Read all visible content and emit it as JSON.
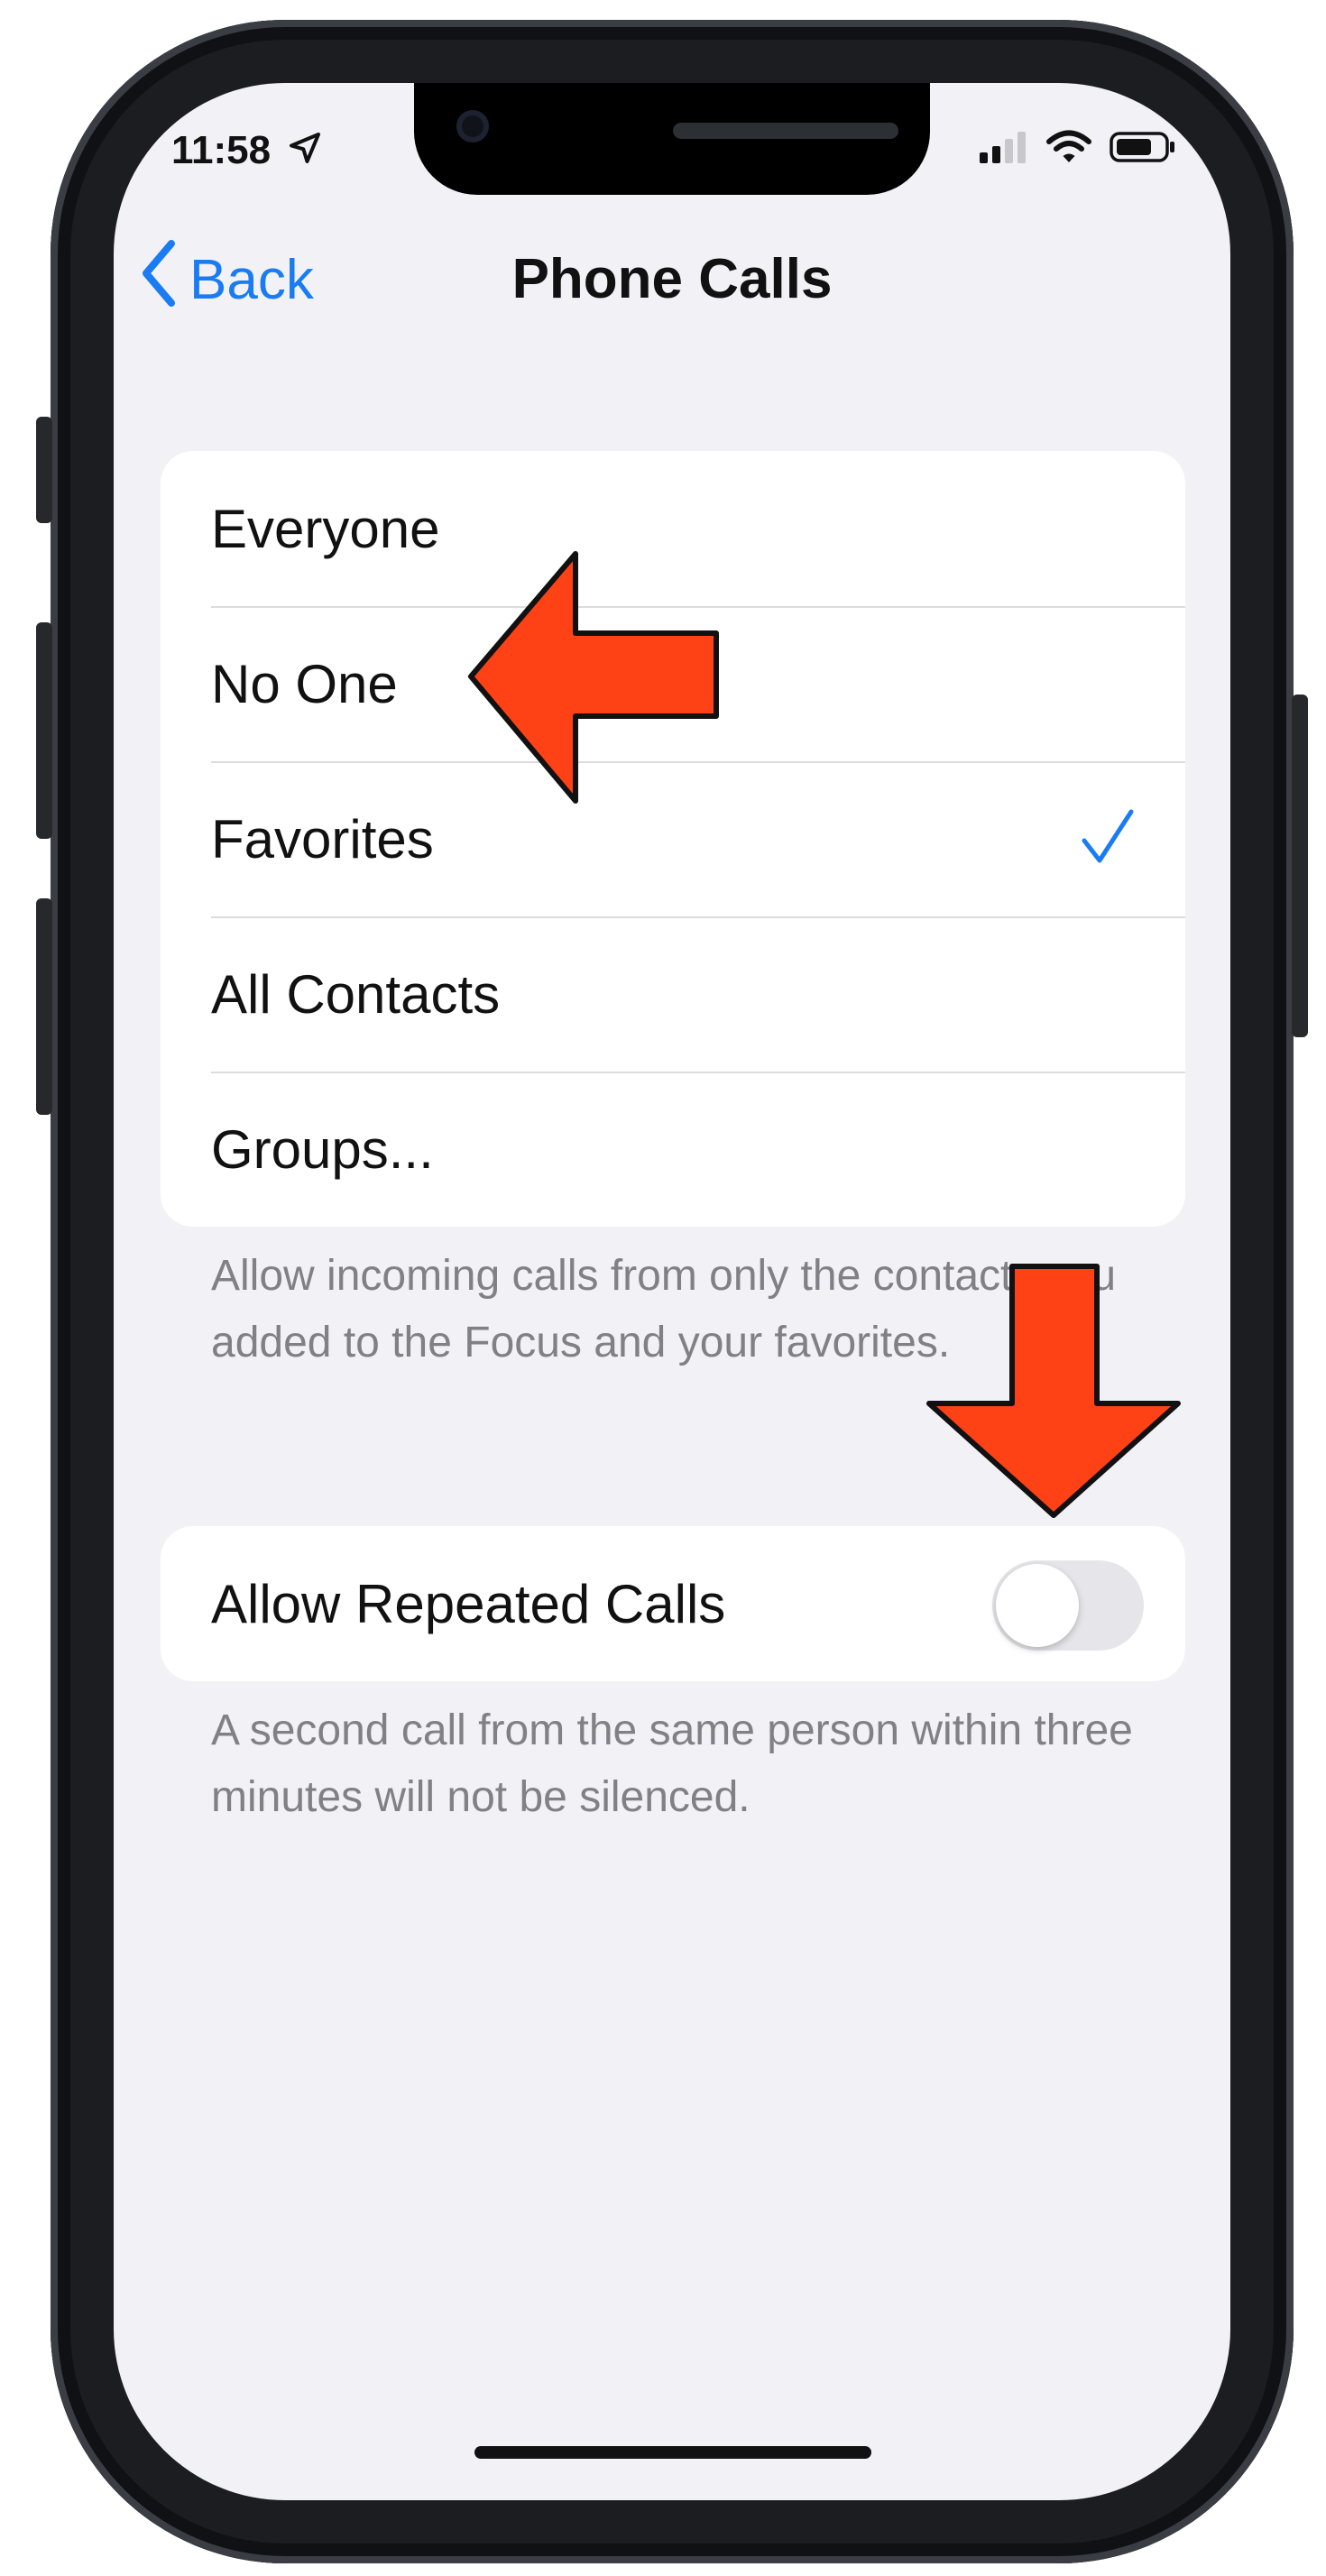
{
  "status_bar": {
    "time": "11:58"
  },
  "nav": {
    "back_label": "Back",
    "title": "Phone Calls"
  },
  "options": [
    {
      "label": "Everyone",
      "selected": false
    },
    {
      "label": "No One",
      "selected": false
    },
    {
      "label": "Favorites",
      "selected": true
    },
    {
      "label": "All Contacts",
      "selected": false
    },
    {
      "label": "Groups...",
      "selected": false
    }
  ],
  "options_footer": "Allow incoming calls from only the contacts you added to the Focus and your favorites.",
  "repeated_calls": {
    "label": "Allow Repeated Calls",
    "enabled": false,
    "footer": "A second call from the same person within three minutes will not be silenced."
  },
  "colors": {
    "accent": "#1a7cf2",
    "annotation_arrow": "#ff4216",
    "background": "#f2f1f6"
  },
  "icons": [
    "location-arrow-icon",
    "cellular-signal-icon",
    "wifi-icon",
    "battery-icon",
    "chevron-left-icon",
    "checkmark-icon"
  ]
}
